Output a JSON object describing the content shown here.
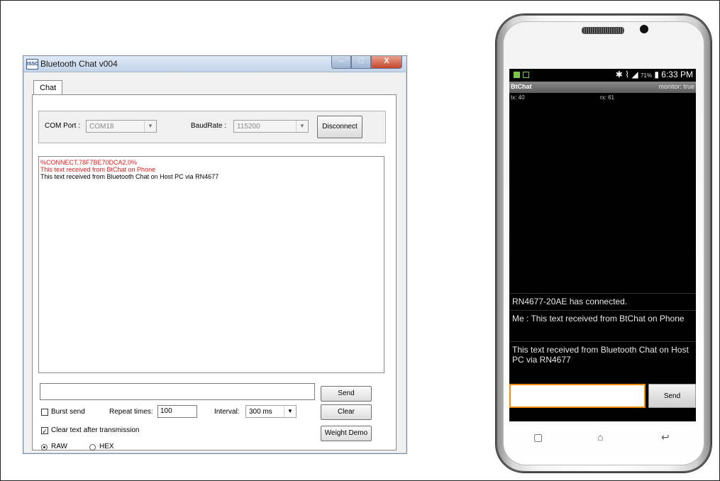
{
  "window": {
    "title": "Bluetooth Chat v004",
    "icon_text": "ISSC",
    "title_buttons": [
      "–",
      "□",
      "X"
    ],
    "tab": "Chat",
    "com_port_label": "COM Port :",
    "com_port_value": "COM18",
    "baud_label": "BaudRate :",
    "baud_value": "115200",
    "disconnect_label": "Disconnect",
    "chat_lines": [
      {
        "text": "%CONNECT,78F7BE70DCA2,0%",
        "color": "#e31a1a"
      },
      {
        "text": "This text received from BtChat on Phone",
        "color": "#e31a1a"
      },
      {
        "text": "This text received from Bluetooth Chat on Host PC via RN4677",
        "color": "#000000"
      }
    ],
    "send_label": "Send",
    "burst_label": "Burst send",
    "repeat_label": "Repeat times:",
    "repeat_value": "100",
    "interval_label": "Interval:",
    "interval_value": "300 ms",
    "clear_label": "Clear",
    "clear_after_label": "Clear text after transmission",
    "weight_label": "Weight Demo",
    "raw_label": "RAW",
    "hex_label": "HEX"
  },
  "phone": {
    "status_right": "6:33 PM",
    "battery_pct": "71%",
    "app_title": "BtChat",
    "monitor": "monitor: true",
    "tx": "tx: 40",
    "rx": "rx: 61",
    "messages": [
      "RN4677-20AE has connected.",
      "Me : This text received from BtChat on Phone",
      "This text received from Bluetooth Chat on Host PC via RN4677"
    ],
    "send_label": "Send",
    "nav": [
      "▢",
      "⌂",
      "↩"
    ]
  }
}
